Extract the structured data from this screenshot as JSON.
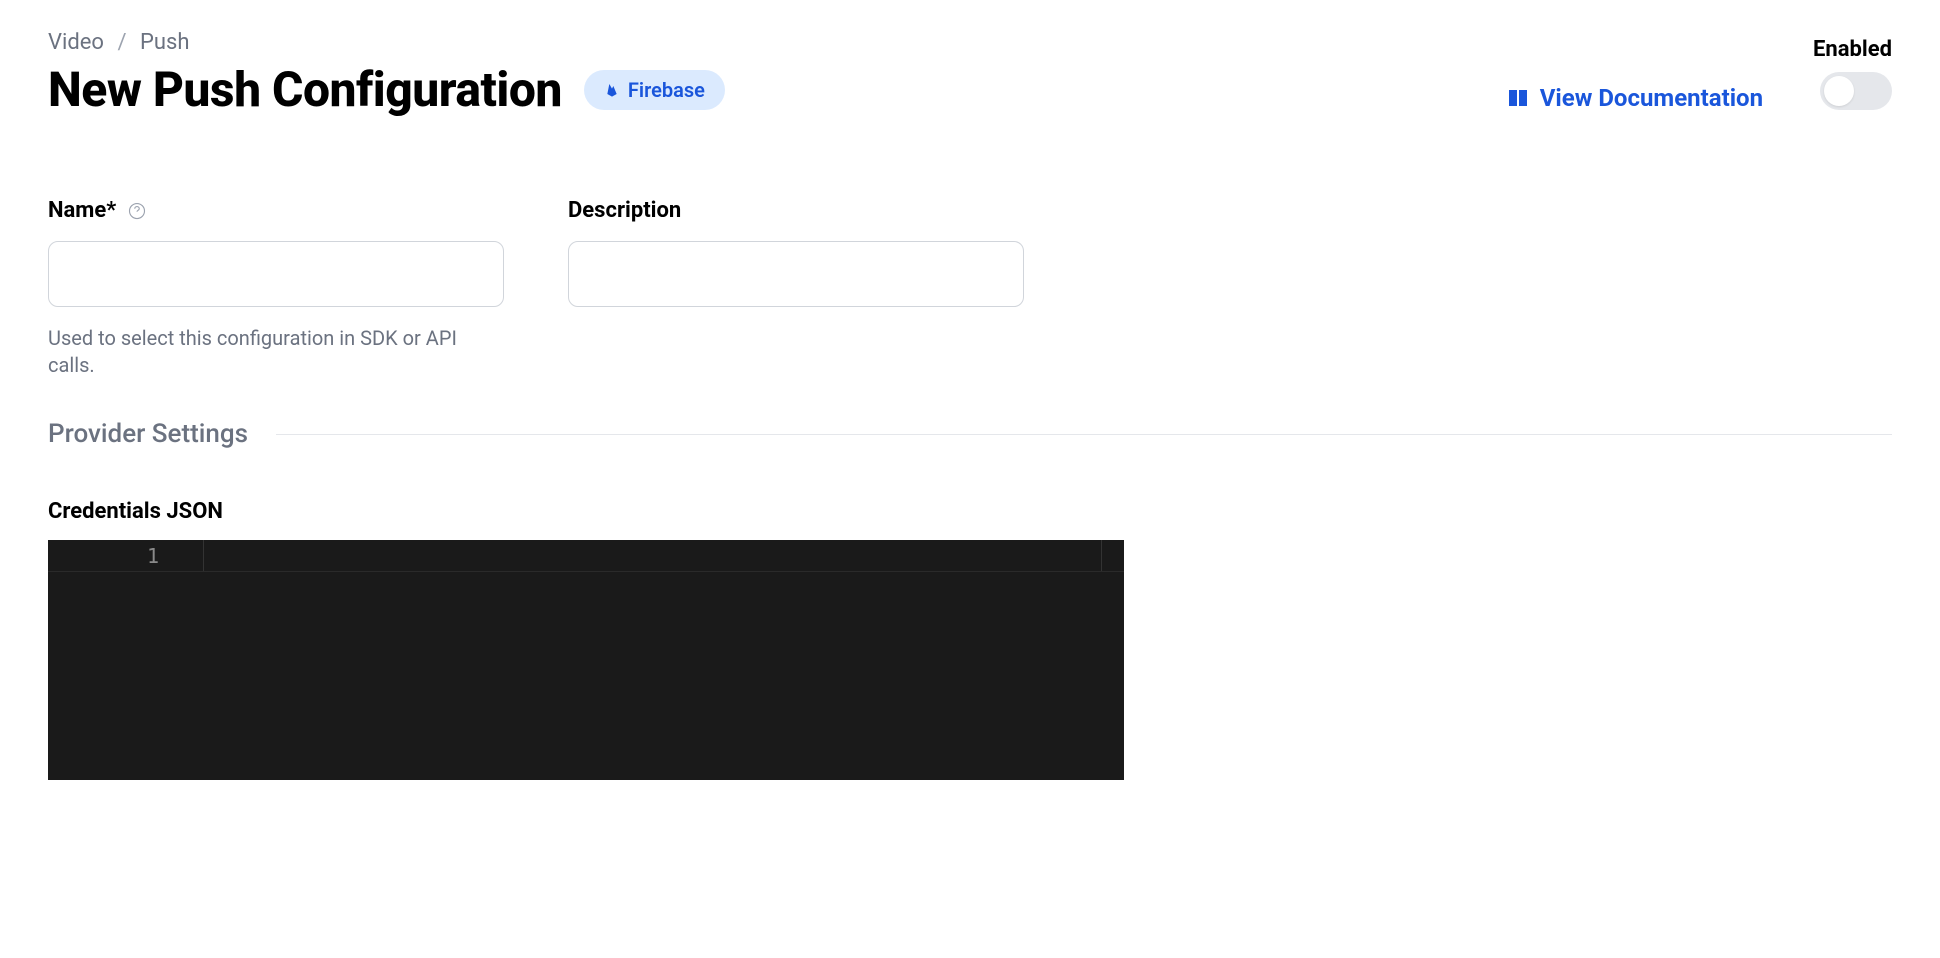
{
  "breadcrumb": {
    "item1": "Video",
    "item2": "Push"
  },
  "header": {
    "title": "New Push Configuration",
    "badge": "Firebase",
    "docLink": "View Documentation",
    "enabledLabel": "Enabled",
    "enabled": false
  },
  "form": {
    "name": {
      "label": "Name*",
      "value": "",
      "hint": "Used to select this configuration in SDK or API calls."
    },
    "description": {
      "label": "Description",
      "value": ""
    }
  },
  "providerSection": {
    "title": "Provider Settings",
    "credentialsLabel": "Credentials JSON",
    "editor": {
      "lineNumber": "1",
      "content": ""
    }
  }
}
